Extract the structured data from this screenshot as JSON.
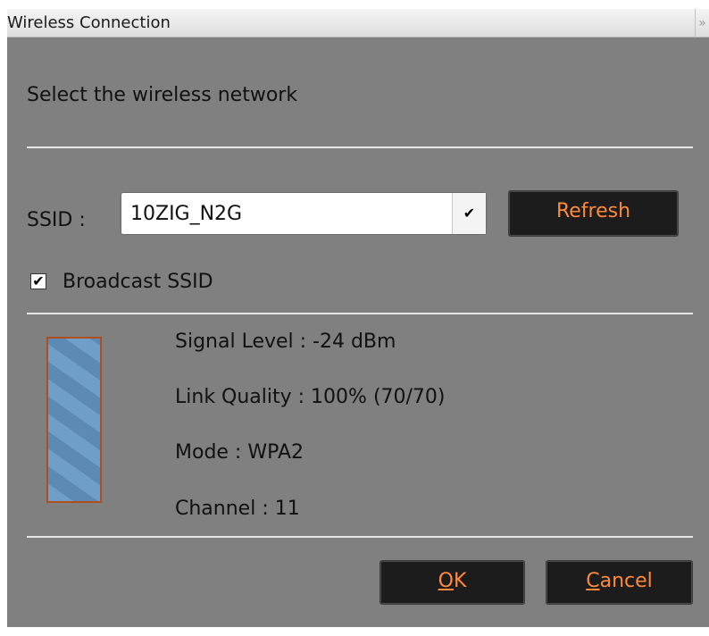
{
  "window": {
    "title": "Wireless Connection",
    "close_glyph": "»"
  },
  "heading": "Select the wireless network",
  "ssid": {
    "label": "SSID :",
    "selected": "10ZIG_N2G",
    "dropdown_icon": "chevron-down-icon"
  },
  "refresh_label": "Refresh",
  "broadcast": {
    "label": "Broadcast SSID",
    "checked": true
  },
  "signal": {
    "level_fraction": 1.0,
    "bar_color": "#6f9ec9",
    "border_color": "#b14e1e"
  },
  "info": {
    "signal_level": "Signal Level : -24 dBm",
    "link_quality": "Link Quality : 100% (70/70)",
    "mode": "Mode : WPA2",
    "channel": "Channel : 11"
  },
  "buttons": {
    "ok": {
      "mnemonic": "O",
      "rest": "K"
    },
    "cancel": {
      "mnemonic": "C",
      "rest": "ancel"
    }
  },
  "colors": {
    "accent": "#ff8a3c",
    "dialog_bg": "#808080",
    "button_bg": "#1c1c1c"
  }
}
